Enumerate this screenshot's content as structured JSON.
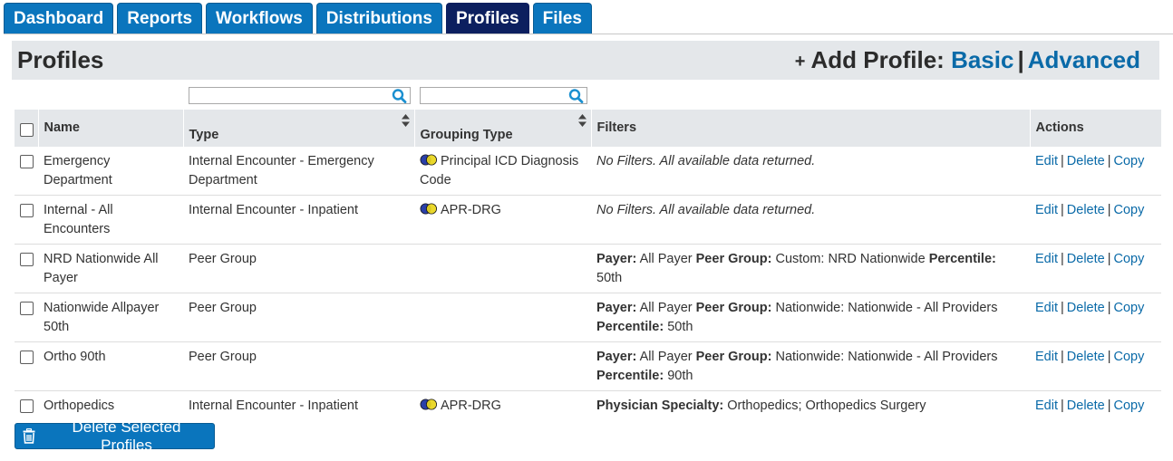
{
  "tabs": [
    {
      "label": "Dashboard",
      "active": false
    },
    {
      "label": "Reports",
      "active": false
    },
    {
      "label": "Workflows",
      "active": false
    },
    {
      "label": "Distributions",
      "active": false
    },
    {
      "label": "Profiles",
      "active": true
    },
    {
      "label": "Files",
      "active": false
    }
  ],
  "header": {
    "title": "Profiles",
    "add_profile_icon": "+",
    "add_profile_label": "Add Profile:",
    "basic_link": "Basic",
    "separator": "|",
    "advanced_link": "Advanced"
  },
  "search": {
    "type_filter": {
      "value": "",
      "icon": "search-icon"
    },
    "grouping_filter": {
      "value": "",
      "icon": "search-icon"
    }
  },
  "table": {
    "columns": {
      "name": "Name",
      "type": "Type",
      "grouping_type": "Grouping Type",
      "filters": "Filters",
      "actions": "Actions"
    },
    "actions": {
      "edit": "Edit",
      "delete": "Delete",
      "copy": "Copy",
      "separator": "|"
    },
    "no_filters_text": "No Filters. All available data returned.",
    "filter_labels": {
      "payer": "Payer:",
      "peer_group": "Peer Group:",
      "percentile": "Percentile:",
      "physician_specialty": "Physician Specialty:"
    },
    "rows": [
      {
        "name": "Emergency Department",
        "type": "Internal Encounter - Emergency Department",
        "grouping_type": "Principal ICD Diagnosis Code",
        "filters": {
          "kind": "none"
        }
      },
      {
        "name": "Internal - All Encounters",
        "type": "Internal Encounter - Inpatient",
        "grouping_type": "APR-DRG",
        "filters": {
          "kind": "none"
        }
      },
      {
        "name": "NRD Nationwide All Payer",
        "type": "Peer Group",
        "grouping_type": "",
        "filters": {
          "kind": "peer",
          "payer": "All Payer",
          "peer_group": "Custom: NRD Nationwide",
          "percentile": "50th"
        }
      },
      {
        "name": "Nationwide Allpayer 50th",
        "type": "Peer Group",
        "grouping_type": "",
        "filters": {
          "kind": "peer",
          "payer": "All Payer",
          "peer_group": "Nationwide: Nationwide - All Providers",
          "percentile": "50th"
        }
      },
      {
        "name": "Ortho 90th",
        "type": "Peer Group",
        "grouping_type": "",
        "filters": {
          "kind": "peer",
          "payer": "All Payer",
          "peer_group": "Nationwide: Nationwide - All Providers",
          "percentile": "90th"
        }
      },
      {
        "name": "Orthopedics",
        "type": "Internal Encounter - Inpatient",
        "grouping_type": "APR-DRG",
        "filters": {
          "kind": "specialty",
          "physician_specialty": "Orthopedics; Orthopedics Surgery"
        }
      }
    ]
  },
  "footer": {
    "delete_selected_label": "Delete Selected Profiles",
    "delete_icon": "trash-icon"
  },
  "colors": {
    "tab_bg": "#0a75bd",
    "tab_active_bg": "#0c1f5f",
    "link": "#0a6aa8",
    "header_bg": "#e4e7ea"
  }
}
